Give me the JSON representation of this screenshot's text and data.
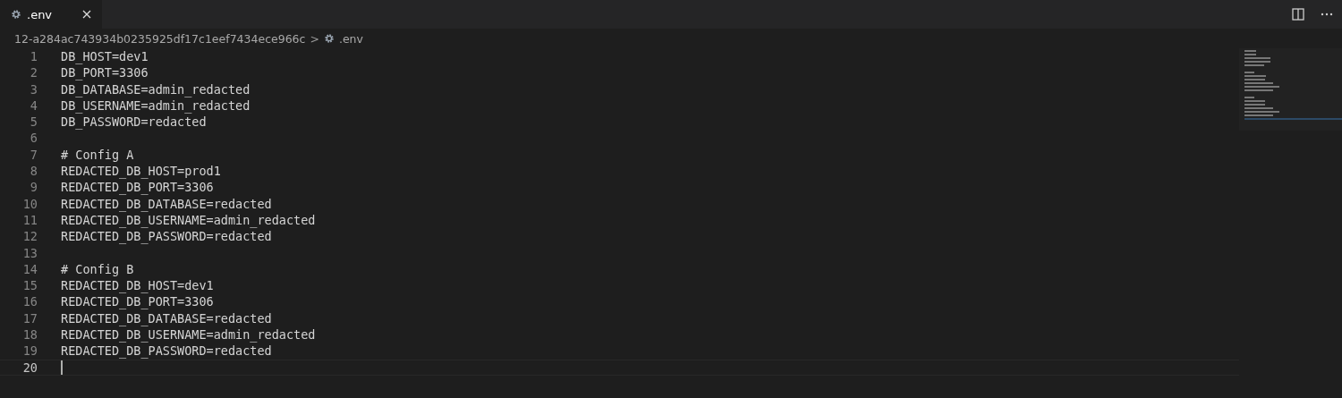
{
  "tabs": [
    {
      "label": ".env",
      "selected": true
    }
  ],
  "breadcrumb": {
    "folder": "12-a284ac743934b0235925df17c1eef7434ece966c",
    "separator": ">",
    "file": ".env"
  },
  "editor": {
    "lines": [
      {
        "number": "1",
        "text": "DB_HOST=dev1",
        "current": false
      },
      {
        "number": "2",
        "text": "DB_PORT=3306",
        "current": false
      },
      {
        "number": "3",
        "text": "DB_DATABASE=admin_redacted",
        "current": false
      },
      {
        "number": "4",
        "text": "DB_USERNAME=admin_redacted",
        "current": false
      },
      {
        "number": "5",
        "text": "DB_PASSWORD=redacted",
        "current": false
      },
      {
        "number": "6",
        "current": false
      },
      {
        "number": "7",
        "text": "# Config A",
        "current": false
      },
      {
        "number": "8",
        "text": "REDACTED_DB_HOST=prod1",
        "current": false
      },
      {
        "number": "9",
        "text": "REDACTED_DB_PORT=3306",
        "current": false
      },
      {
        "number": "10",
        "text": "REDACTED_DB_DATABASE=redacted",
        "current": false
      },
      {
        "number": "11",
        "text": "REDACTED_DB_USERNAME=admin_redacted",
        "current": false
      },
      {
        "number": "12",
        "text": "REDACTED_DB_PASSWORD=redacted",
        "current": false
      },
      {
        "number": "13",
        "current": false
      },
      {
        "number": "14",
        "text": "# Config B",
        "current": false
      },
      {
        "number": "15",
        "text": "REDACTED_DB_HOST=dev1",
        "current": false
      },
      {
        "number": "16",
        "text": "REDACTED_DB_PORT=3306",
        "current": false
      },
      {
        "number": "17",
        "text": "REDACTED_DB_DATABASE=redacted",
        "current": false
      },
      {
        "number": "18",
        "text": "REDACTED_DB_USERNAME=admin_redacted",
        "current": false
      },
      {
        "number": "19",
        "text": "REDACTED_DB_PASSWORD=redacted",
        "current": false
      },
      {
        "number": "20",
        "current": true
      }
    ]
  }
}
